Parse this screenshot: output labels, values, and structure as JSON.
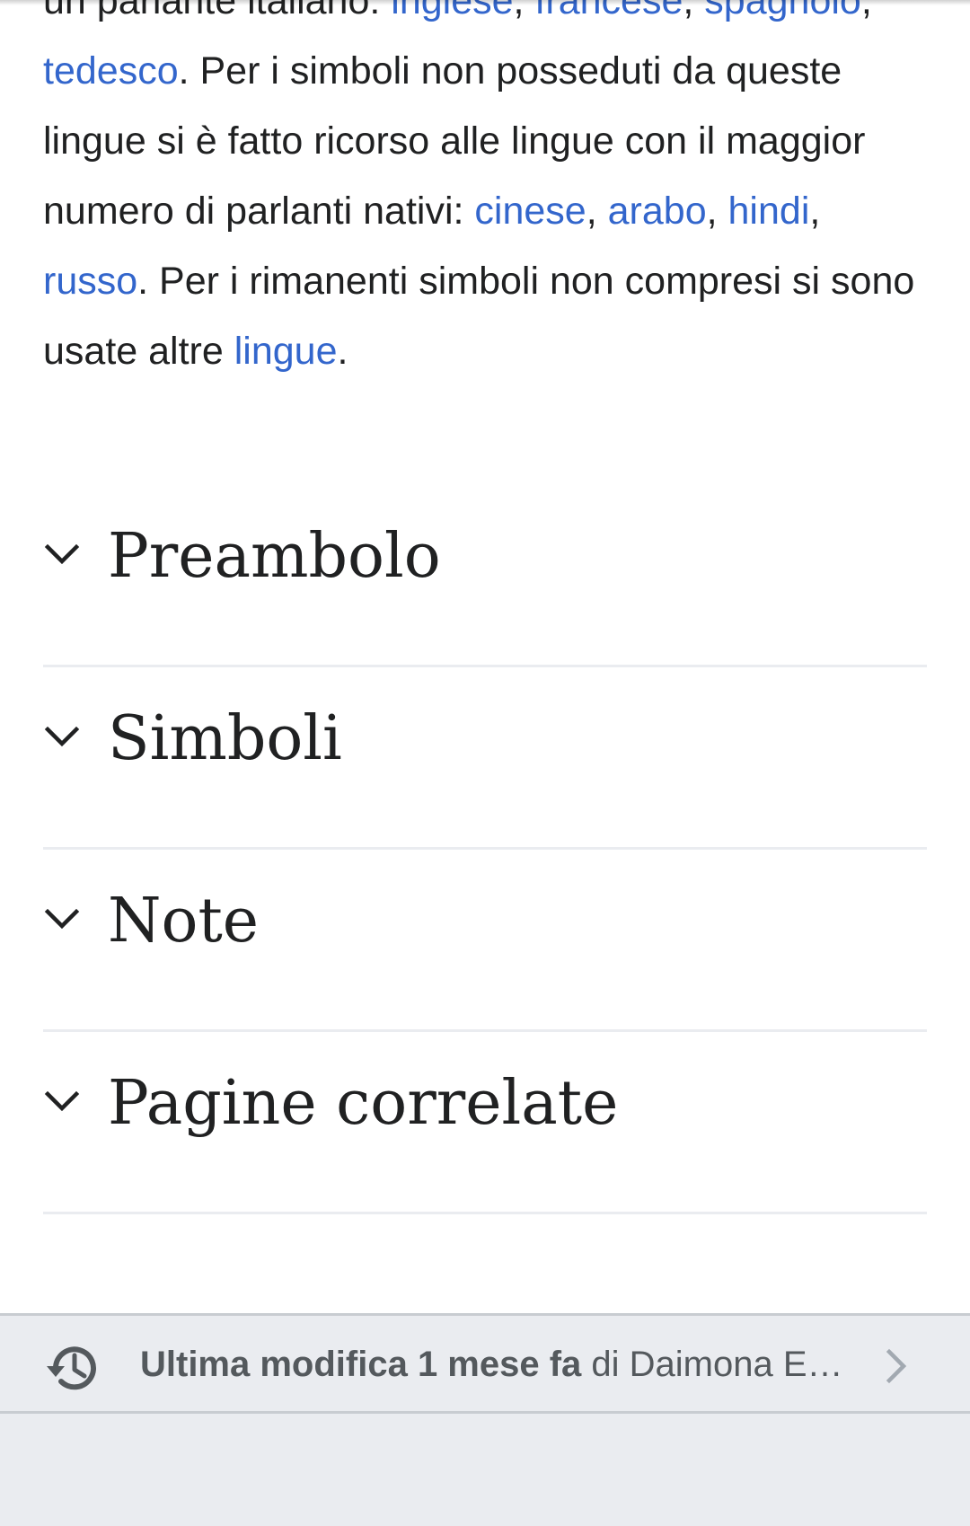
{
  "article": {
    "line1_text": "un parlante italiano: ",
    "link_inglese": "inglese",
    "comma1": ", ",
    "link_francese": "francese",
    "comma2": ",",
    "link_spagnolo": "spagnolo",
    "comma3": ", ",
    "link_tedesco": "tedesco",
    "text_after_tedesco": ". Per i simboli non posseduti da queste lingue si è fatto ricorso alle lingue con il maggior numero di parlanti nativi: ",
    "link_cinese": "cinese",
    "comma4": ", ",
    "link_arabo": "arabo",
    "comma5": ", ",
    "link_hindi": "hindi",
    "comma6": ", ",
    "link_russo": "russo",
    "text_after_russo": ". Per i rimanenti simboli non compresi si sono usate altre ",
    "link_lingue": "lingue",
    "final_period": "."
  },
  "sections": [
    {
      "title": "Preambolo",
      "icon": "chevron-down-icon"
    },
    {
      "title": "Simboli",
      "icon": "chevron-down-icon"
    },
    {
      "title": "Note",
      "icon": "chevron-down-icon"
    },
    {
      "title": "Pagine correlate",
      "icon": "chevron-down-icon"
    }
  ],
  "footer": {
    "last_modified_bold": "Ultima modifica 1 mese fa",
    "by_text": " di Daimona E…",
    "icon": "history-icon",
    "arrow_icon": "chevron-right-icon"
  },
  "colors": {
    "link": "#3366cc",
    "text": "#202122",
    "footer_bg": "#eaecf0",
    "divider": "#eaecf0"
  }
}
